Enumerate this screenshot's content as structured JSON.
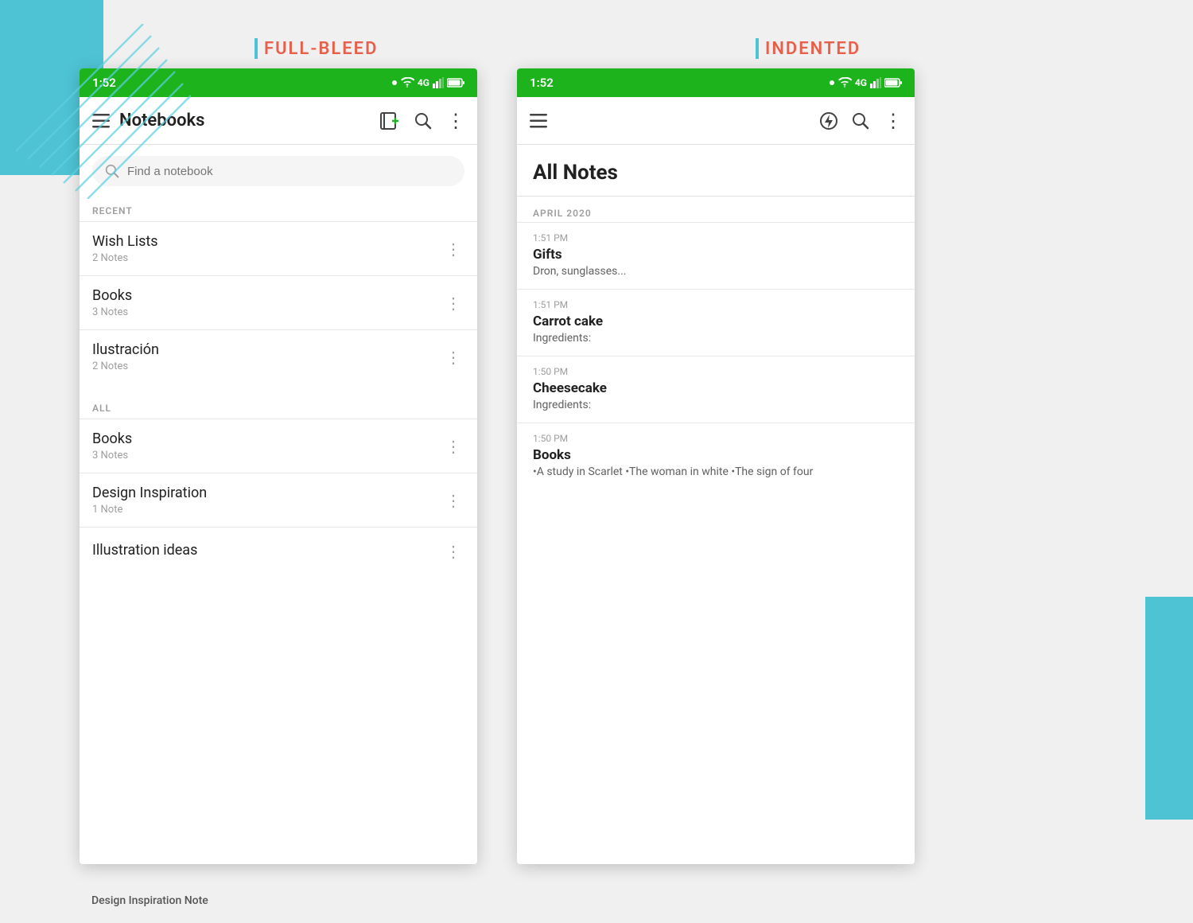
{
  "background": {
    "accent_color": "#4ec3d4",
    "label_color": "#e8604c"
  },
  "left_panel": {
    "label": "FULL-BLEED",
    "status_bar": {
      "time": "1:52",
      "signal_dot": "•",
      "wifi": "wifi",
      "network": "4G",
      "battery": "battery"
    },
    "toolbar": {
      "menu_icon": "☰",
      "title": "Notebooks",
      "notebook_add_icon": "📓+",
      "search_icon": "🔍",
      "more_icon": "⋮"
    },
    "search": {
      "placeholder": "Find a notebook"
    },
    "recent_section": "RECENT",
    "recent_notebooks": [
      {
        "name": "Wish Lists",
        "count": "2 Notes"
      },
      {
        "name": "Books",
        "count": "3 Notes"
      },
      {
        "name": "Ilustración",
        "count": "2 Notes"
      }
    ],
    "all_section": "ALL",
    "all_notebooks": [
      {
        "name": "Books",
        "count": "3 Notes"
      },
      {
        "name": "Design Inspiration",
        "count": "1 Note"
      },
      {
        "name": "Illustration ideas",
        "count": ""
      }
    ]
  },
  "right_panel": {
    "label": "INDENTED",
    "status_bar": {
      "time": "1:52",
      "signal_dot": "•",
      "wifi": "wifi",
      "network": "4G",
      "battery": "battery"
    },
    "toolbar": {
      "menu_icon": "☰",
      "flash_icon": "⚡",
      "search_icon": "🔍",
      "more_icon": "⋮"
    },
    "page_title": "All Notes",
    "date_label": "APRIL 2020",
    "notes": [
      {
        "time": "1:51 PM",
        "title": "Gifts",
        "preview": "Dron, sunglasses..."
      },
      {
        "time": "1:51 PM",
        "title": "Carrot cake",
        "preview": "Ingredients:"
      },
      {
        "time": "1:50 PM",
        "title": "Cheesecake",
        "preview": "Ingredients:"
      },
      {
        "time": "1:50 PM",
        "title": "Books",
        "preview": "•A study in Scarlet •The woman in white •The sign of four"
      }
    ]
  },
  "bottom_note": {
    "title": "Design Inspiration Note"
  }
}
